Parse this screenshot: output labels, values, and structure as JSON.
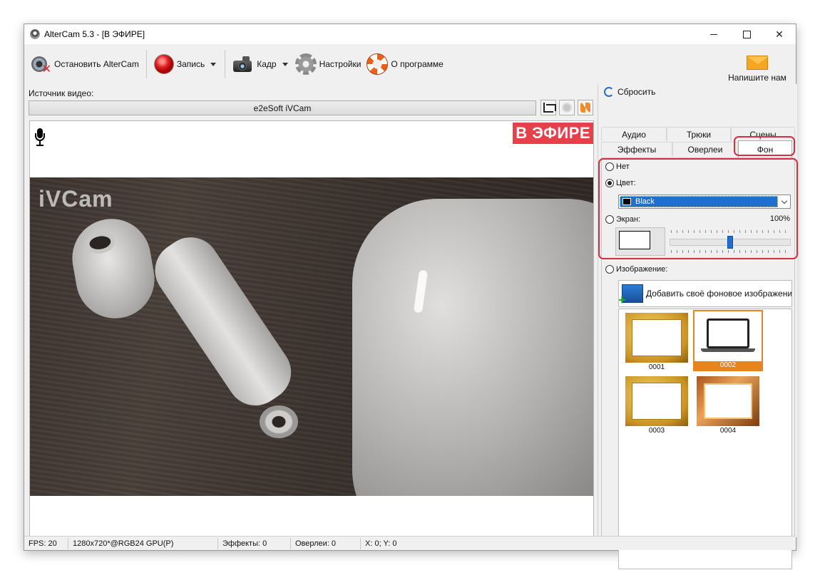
{
  "window": {
    "title": "AlterCam 5.3 - [В ЭФИРЕ]",
    "controls": {
      "minimize": "",
      "maximize": "",
      "close": "✕"
    }
  },
  "toolbar": {
    "stop_label": "Остановить AlterCam",
    "record_label": "Запись",
    "frame_label": "Кадр",
    "settings_label": "Настройки",
    "about_label": "О программе",
    "mail_label": "Напишите нам"
  },
  "source": {
    "label": "Источник видео:",
    "selected": "e2eSoft iVCam"
  },
  "video": {
    "onair_badge": "В ЭФИРЕ",
    "watermark": "iVCam"
  },
  "statusbar": {
    "fps": "FPS: 20",
    "format": "1280x720*@RGB24 GPU(P)",
    "effects": "Эффекты: 0",
    "overlays": "Оверлеи: 0",
    "coords": "X: 0; Y: 0"
  },
  "panel": {
    "reset_label": "Сбросить",
    "tabs_row1": [
      "Аудио",
      "Трюки",
      "Сцены"
    ],
    "tabs_row2": [
      "Эффекты",
      "Оверлеи",
      "Фон"
    ],
    "active_tab": "Фон",
    "options": {
      "none_label": "Нет",
      "color_label": "Цвет:",
      "color_value": "Black",
      "color_swatch": "#000000",
      "screen_label": "Экран:",
      "screen_percent": "100%",
      "screen_opacity": 100,
      "image_label": "Изображение:",
      "selected_option": "Цвет:"
    },
    "add_image_label": "Добавить своё фоновое изображение",
    "thumbnails": [
      {
        "caption": "0001",
        "selected": false
      },
      {
        "caption": "0002",
        "selected": true
      },
      {
        "caption": "0003",
        "selected": false
      },
      {
        "caption": "0004",
        "selected": false
      }
    ]
  },
  "colors": {
    "accent_blue": "#1e6fd0",
    "onair_red": "#e8404a",
    "highlight_red": "#d33040",
    "selection_orange": "#e8841e"
  }
}
